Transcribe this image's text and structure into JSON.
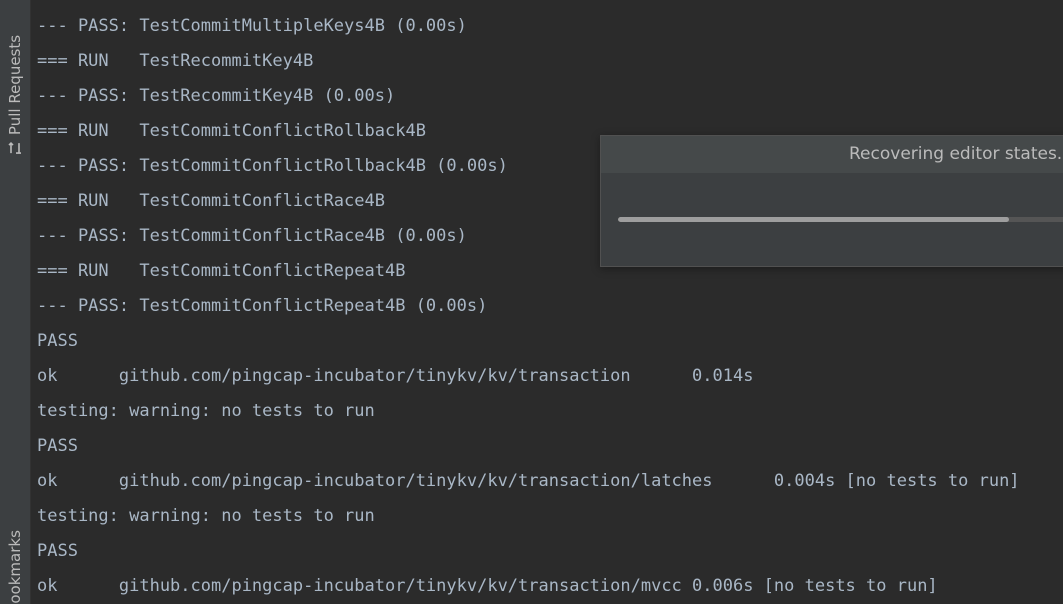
{
  "sidebar": {
    "pull_requests_label": "Pull Requests",
    "bookmarks_label": "Bookmarks",
    "pull_requests_icon": "pull-request-icon"
  },
  "console": {
    "lines": [
      "--- PASS: TestCommitMultipleKeys4B (0.00s)",
      "=== RUN   TestRecommitKey4B",
      "--- PASS: TestRecommitKey4B (0.00s)",
      "=== RUN   TestCommitConflictRollback4B",
      "--- PASS: TestCommitConflictRollback4B (0.00s)",
      "=== RUN   TestCommitConflictRace4B",
      "--- PASS: TestCommitConflictRace4B (0.00s)",
      "=== RUN   TestCommitConflictRepeat4B",
      "--- PASS: TestCommitConflictRepeat4B (0.00s)",
      "PASS",
      "ok      github.com/pingcap-incubator/tinykv/kv/transaction      0.014s",
      "testing: warning: no tests to run",
      "PASS",
      "ok      github.com/pingcap-incubator/tinykv/kv/transaction/latches      0.004s [no tests to run]",
      "testing: warning: no tests to run",
      "PASS",
      "ok      github.com/pingcap-incubator/tinykv/kv/transaction/mvcc 0.006s [no tests to run]"
    ]
  },
  "dialog": {
    "title": "Recovering editor states...",
    "progress_fraction": 0.85
  },
  "colors": {
    "background": "#2b2b2b",
    "console_text": "#a9b7c6",
    "dialog_bg": "#3c3f41",
    "progress_fill": "#9e9e9e"
  }
}
